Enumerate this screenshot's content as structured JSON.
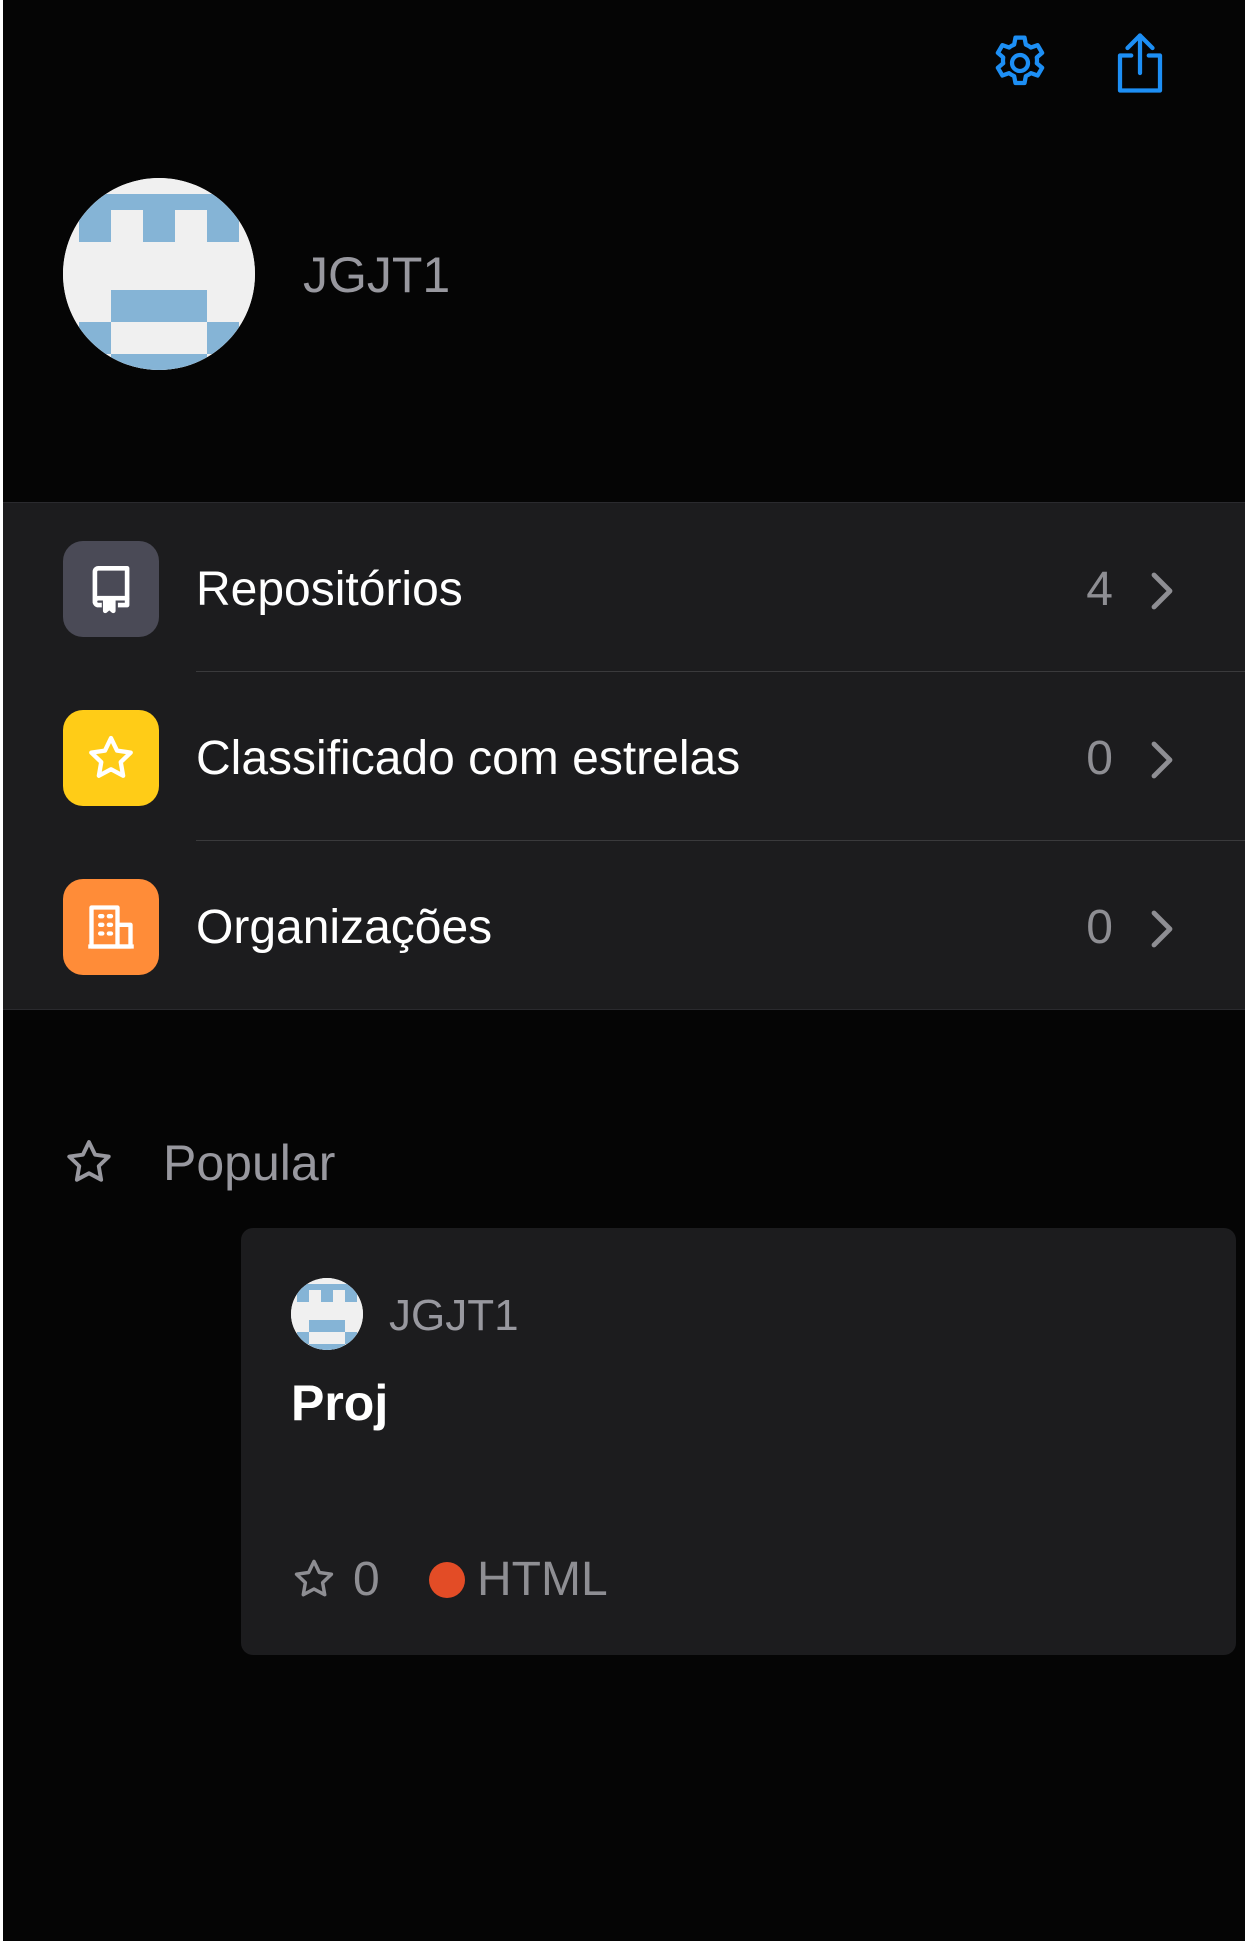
{
  "header": {
    "settings_icon": "gear-icon",
    "share_icon": "share-icon"
  },
  "profile": {
    "username": "JGJT1"
  },
  "menu": {
    "items": [
      {
        "label": "Repositórios",
        "count": "4",
        "icon": "repo-icon",
        "color": "#4a4a56"
      },
      {
        "label": "Classificado com estrelas",
        "count": "0",
        "icon": "star-icon",
        "color": "#ffcc17"
      },
      {
        "label": "Organizações",
        "count": "0",
        "icon": "organization-icon",
        "color": "#ff8c38"
      }
    ]
  },
  "popular": {
    "label": "Popular",
    "cards": [
      {
        "owner": "JGJT1",
        "title": "Proj",
        "stars": "0",
        "language": "HTML",
        "language_color": "#e34c26"
      }
    ]
  },
  "colors": {
    "accent": "#1d8ff5",
    "background": "#050505",
    "surface": "#1c1c1e"
  }
}
